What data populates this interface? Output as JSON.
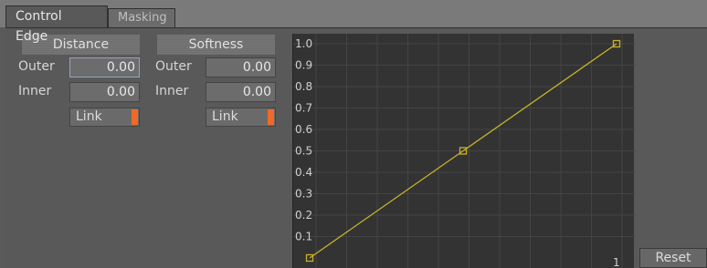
{
  "tabs": [
    {
      "label": "Control Edge"
    },
    {
      "label": "Masking"
    }
  ],
  "distance": {
    "header": "Distance",
    "outer_label": "Outer",
    "outer_value": "0.00",
    "inner_label": "Inner",
    "inner_value": "0.00",
    "link_label": "Link"
  },
  "softness": {
    "header": "Softness",
    "outer_label": "Outer",
    "outer_value": "0.00",
    "inner_label": "Inner",
    "inner_value": "0.00",
    "link_label": "Link"
  },
  "graph": {
    "y_ticks": [
      "1.0",
      "0.9",
      "0.8",
      "0.7",
      "0.6",
      "0.5",
      "0.4",
      "0.3",
      "0.2",
      "0.1"
    ],
    "x_end_label": "1",
    "curve_points": [
      {
        "x": 0,
        "y": 0
      },
      {
        "x": 0.5,
        "y": 0.5
      },
      {
        "x": 1,
        "y": 1
      }
    ],
    "curve_color": "#c8b22a",
    "grid_color": "#444444"
  },
  "reset_label": "Reset",
  "link_indicator_color": "#ee6a26"
}
